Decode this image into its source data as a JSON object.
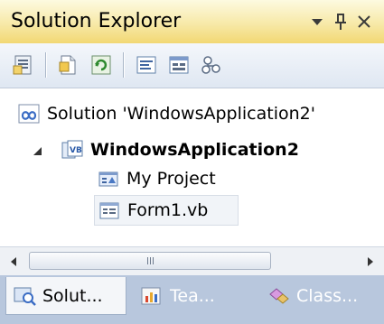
{
  "window": {
    "title": "Solution Explorer"
  },
  "tree": {
    "solution_label": "Solution 'WindowsApplication2'",
    "project_label": "WindowsApplication2",
    "my_project_label": "My Project",
    "form_label": "Form1.vb"
  },
  "tabs": [
    {
      "label": "Solut...",
      "icon": "solution-explorer-icon",
      "active": true
    },
    {
      "label": "Tea...",
      "icon": "team-explorer-icon",
      "active": false
    },
    {
      "label": "Class...",
      "icon": "class-view-icon",
      "active": false
    }
  ],
  "colors": {
    "title_gradient_top": "#fdfae0",
    "title_gradient_bottom": "#f2d873",
    "tab_strip": "#b8c7dd"
  }
}
